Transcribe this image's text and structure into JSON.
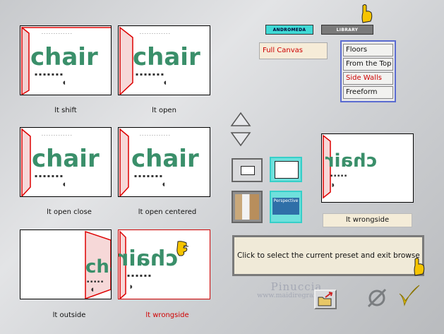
{
  "tabs": [
    {
      "label": "ANDROMEDA",
      "active": true
    },
    {
      "label": "LIBRARY",
      "active": false
    }
  ],
  "canvas_select": {
    "value": "Full Canvas"
  },
  "category_menu": {
    "items": [
      {
        "label": "Floors",
        "active": false
      },
      {
        "label": "From the Top",
        "active": false
      },
      {
        "label": "Side Walls",
        "active": true
      },
      {
        "label": "Freeform",
        "active": false
      }
    ]
  },
  "thumbnails": [
    {
      "caption": "lt shift",
      "thumb_text": "chair",
      "selected": false
    },
    {
      "caption": "lt open",
      "thumb_text": "chair",
      "selected": false
    },
    {
      "caption": "lt open close",
      "thumb_text": "chair",
      "selected": false
    },
    {
      "caption": "lt open centered",
      "thumb_text": "chair",
      "selected": false
    },
    {
      "caption": "lt outside",
      "thumb_text": "chair",
      "selected": false
    },
    {
      "caption": "lt wrongside",
      "thumb_text": "chair",
      "selected": true
    }
  ],
  "preview": {
    "label": "lt wrongside"
  },
  "perspective_button": {
    "label": "Perspective"
  },
  "status_text": "Click to select the current preset and exit browse mode",
  "watermark": {
    "line1": "Pinuccia",
    "line2": "www.maidiregrafica.eu"
  },
  "colors": {
    "accent_teal": "#3fd9d5",
    "selected_red": "#d00000",
    "menu_border": "#5a6bd0",
    "text_green": "#3a8f6a"
  },
  "icons": [
    "up-arrow-icon",
    "down-arrow-icon",
    "rectangle-icon",
    "wide-rectangle-icon",
    "perspective-icon",
    "open-folder-icon",
    "no-sign-icon",
    "checkmark-icon",
    "pointing-hand-icon"
  ]
}
